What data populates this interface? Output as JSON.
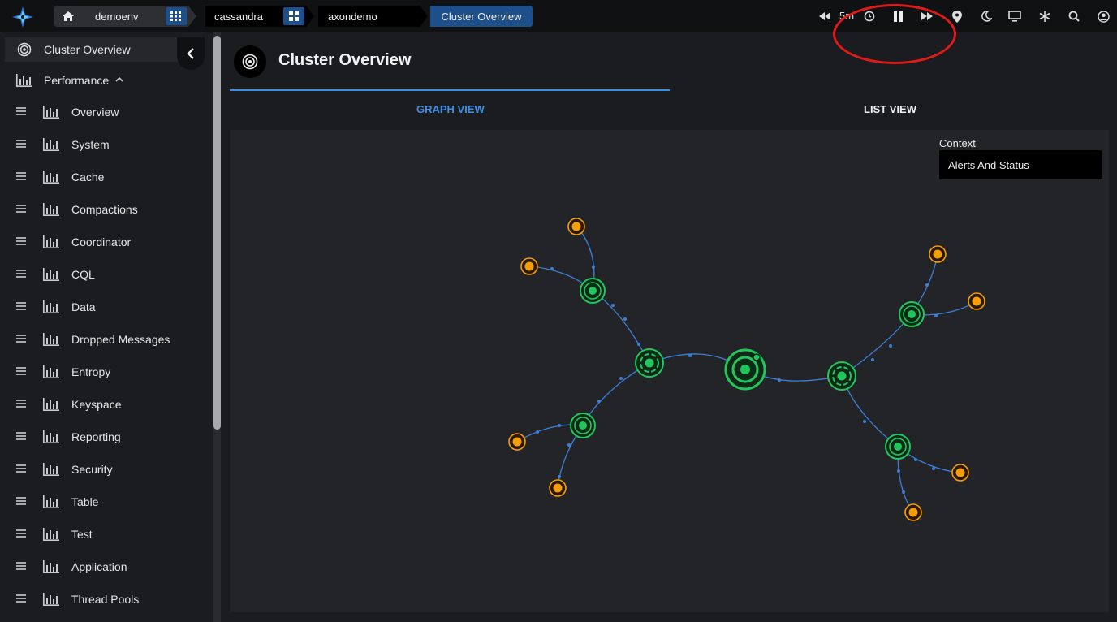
{
  "breadcrumb": {
    "env": "demoenv",
    "cluster_type": "cassandra",
    "cluster": "axondemo",
    "page": "Cluster Overview"
  },
  "toolbar": {
    "time_range": "5m",
    "icons": [
      "rewind-icon",
      "clock-icon",
      "pause-icon",
      "fast-forward-icon",
      "location-pin-icon",
      "moon-icon",
      "monitor-icon",
      "snowflake-icon",
      "search-icon",
      "user-icon"
    ]
  },
  "sidebar": {
    "header_label": "Cluster Overview",
    "section_label": "Performance",
    "items": [
      {
        "label": "Overview"
      },
      {
        "label": "System"
      },
      {
        "label": "Cache"
      },
      {
        "label": "Compactions"
      },
      {
        "label": "Coordinator"
      },
      {
        "label": "CQL"
      },
      {
        "label": "Data"
      },
      {
        "label": "Dropped Messages"
      },
      {
        "label": "Entropy"
      },
      {
        "label": "Keyspace"
      },
      {
        "label": "Reporting"
      },
      {
        "label": "Security"
      },
      {
        "label": "Table"
      },
      {
        "label": "Test"
      },
      {
        "label": "Application"
      },
      {
        "label": "Thread Pools"
      }
    ]
  },
  "main": {
    "title": "Cluster Overview",
    "tabs": [
      {
        "label": "GRAPH VIEW",
        "active": true
      },
      {
        "label": "LIST VIEW",
        "active": false
      }
    ],
    "context_label": "Context",
    "context_value": "Alerts And Status"
  },
  "colors": {
    "accent": "#3e8ee8",
    "node_green": "#22c55e",
    "node_orange": "#f59e0b",
    "edge": "#3e7fd6"
  }
}
